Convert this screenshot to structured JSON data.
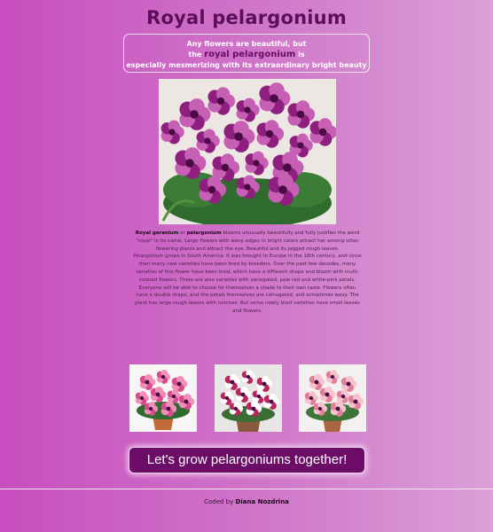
{
  "page": {
    "title": "Royal pelargonium"
  },
  "intro": {
    "line1": "Any flowers are beautiful, but",
    "line2_prefix": "the",
    "highlight": "royal pelargonium",
    "line2_suffix": "is",
    "line3": "especially mesmerizing with its extraordinary bright beauty"
  },
  "article": {
    "p1_term1": "Royal geranium",
    "p1_or": "or",
    "p1_term2": "pelargonium",
    "p1_text": "blooms unusually beautifully and fully justifies the word \"royal\" in its name. Large flowers with wavy edges in bright colors attract her among other flowering plants and attract the eye. Beautiful and its jagged rough leaves.",
    "p2": "Pelargonium grows in South America. It was brought to Europe in the 18th century, and since then many new varieties have been bred by breeders. Over the past few decades, many varieties of this flower have been bred, which have a different shape and bloom with multi-colored flowers. There are also varieties with variegated, pale red and white-pink petals. Everyone will be able to choose for themselves a shade to their own taste. Flowers often have a double shape, and the petals themselves are corrugated, and sometimes wavy. The plant has large rough leaves with notches. But some newly bred varieties have small leaves and flowers."
  },
  "cta": {
    "label": "Let's grow pelargoniums together!"
  },
  "footer": {
    "prefix": "Coded by",
    "author": "Diana Nozdrina"
  },
  "colors": {
    "title": "#5b0f5a",
    "highlight": "#6a0a64",
    "button_bg": "#6b0d66",
    "gradient_start": "#c84ebf",
    "gradient_end": "#dba0d8"
  },
  "images": [
    {
      "name": "hero-pelargonium-photo",
      "petal": "#8e1f7e",
      "accent": "#c75fb4"
    },
    {
      "name": "gallery-pink-pelargonium",
      "petal": "#d64b8c",
      "accent": "#f08fb8"
    },
    {
      "name": "gallery-white-pink-pelargonium",
      "petal": "#b8265e",
      "accent": "#ffffff"
    },
    {
      "name": "gallery-light-pink-pelargonium",
      "petal": "#e07f97",
      "accent": "#f6c2cf"
    }
  ]
}
